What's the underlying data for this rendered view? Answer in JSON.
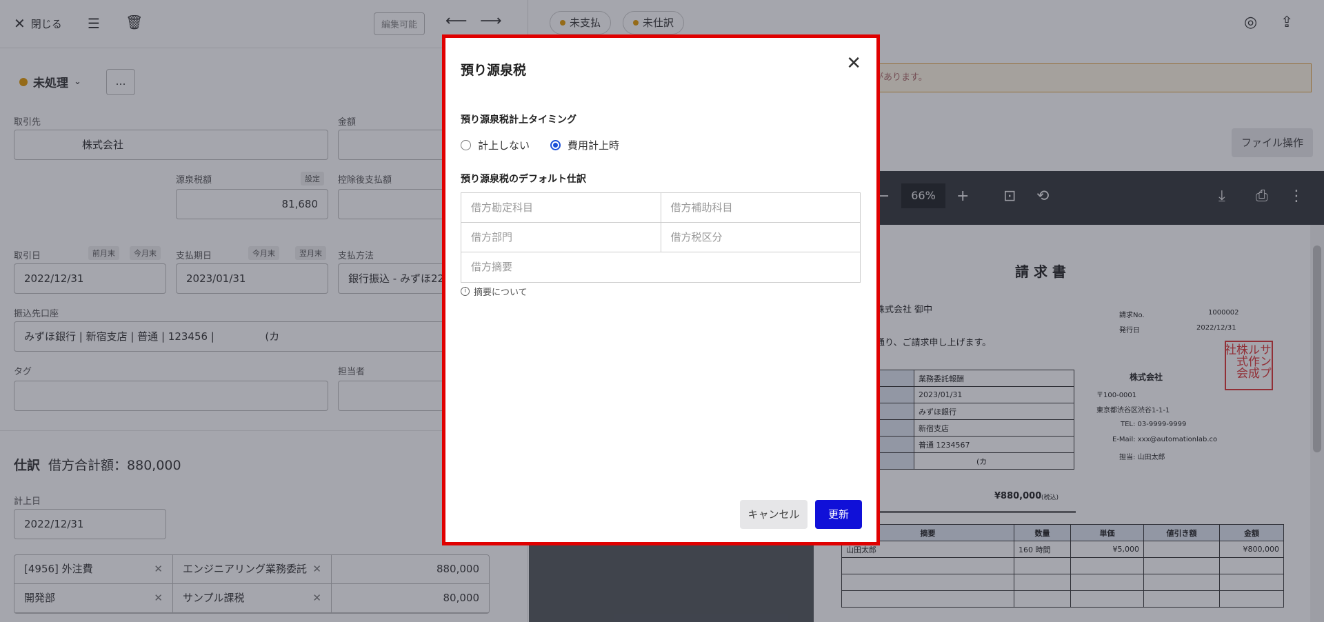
{
  "left": {
    "close_label": "閉じる",
    "edit_label": "編集可能",
    "status_label": "未処理",
    "status_more": "…",
    "fields": {
      "partner_label": "取引先",
      "partner_value": "株式会社",
      "amount_label": "金額",
      "withholding_label": "源泉税額",
      "withholding_chip": "設定",
      "withholding_value": "81,680",
      "after_deduction_label": "控除後支払額",
      "trade_date_label": "取引日",
      "trade_date_chip1": "前月末",
      "trade_date_chip2": "今月末",
      "trade_date_value": "2022/12/31",
      "due_date_label": "支払期日",
      "due_date_chip1": "今月末",
      "due_date_chip2": "翌月末",
      "due_date_value": "2023/01/31",
      "pay_method_label": "支払方法",
      "pay_method_value": "銀行振込 - みずほ22",
      "bank_label": "振込先口座",
      "bank_value": "みずほ銀行 | 新宿支店 | 普通 | 123456 |",
      "bank_value_tail": "(カ",
      "tag_label": "タグ",
      "assignee_label": "担当者"
    },
    "journal": {
      "title": "仕訳",
      "total": "借方合計額：880,000",
      "date_label": "計上日",
      "date_value": "2022/12/31",
      "rows": [
        {
          "account": "[4956] 外注費",
          "sub": "エンジニアリング業務委託",
          "amount": "880,000"
        },
        {
          "account": "開発部",
          "sub": "サンプル課税",
          "amount": "80,000"
        }
      ]
    }
  },
  "right": {
    "pill_unpaid": "未支払",
    "pill_unjournaled": "未仕訳",
    "warning_text": "があります。",
    "file_op_label": "ファイル操作",
    "zoom": "66%",
    "invoice": {
      "title": "請 求 書",
      "to": "株式会社  御中",
      "intro": "通り、ご請求申し上げます。",
      "no_label": "請求No.",
      "no_value": "1000002",
      "date_label": "発行日",
      "date_value": "2022/12/31",
      "company": "株式会社",
      "zip": "〒100-0001",
      "address": "東京都渋谷区渋谷1-1-1",
      "tel": "TEL:  03-9999-9999",
      "email": "E-Mail:  xxx@automationlab.co",
      "person": "担当:  山田太郎",
      "seal": "サンプル作成株式会社",
      "info_rows": [
        "業務委託報酬",
        "2023/01/31",
        "みずほ銀行",
        "新宿支店",
        "普通  1234567",
        "(カ"
      ],
      "total": "¥880,000",
      "total_note": "(税込)",
      "table_head": [
        "摘要",
        "数量",
        "単価",
        "値引き額",
        "金額"
      ],
      "table_row": [
        "山田太郎",
        "160 時間",
        "¥5,000",
        "",
        "¥800,000"
      ]
    }
  },
  "modal": {
    "title": "預り源泉税",
    "timing_label": "預り源泉税計上タイミング",
    "option_none": "計上しない",
    "option_expense": "費用計上時",
    "selected_option": "費用計上時",
    "default_label": "預り源泉税のデフォルト仕訳",
    "placeholders": {
      "debit_account": "借方勘定科目",
      "debit_sub": "借方補助科目",
      "debit_dept": "借方部門",
      "debit_tax": "借方税区分",
      "debit_memo": "借方摘要"
    },
    "info_link": "摘要について",
    "cancel_label": "キャンセル",
    "update_label": "更新",
    "accent_color": "#1010d8",
    "highlight_border_color": "#e00000"
  }
}
